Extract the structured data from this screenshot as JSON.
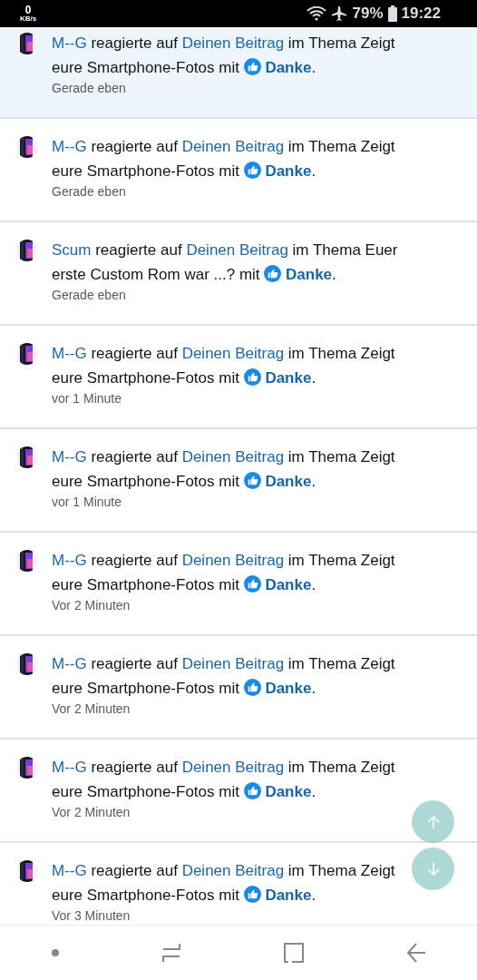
{
  "status_bar": {
    "speed_value": "0",
    "speed_unit": "KB/s",
    "battery": "79%",
    "time": "19:22"
  },
  "notifications": [
    {
      "user": "M--G",
      "verb": "reagierte auf",
      "post": "Deinen Beitrag",
      "middle": "im Thema Zeigt eure Smartphone-Fotos mit",
      "reaction": "Danke",
      "end": ".",
      "time": "Gerade eben",
      "unread": true
    },
    {
      "user": "M--G",
      "verb": "reagierte auf",
      "post": "Deinen Beitrag",
      "middle": "im Thema Zeigt eure Smartphone-Fotos mit",
      "reaction": "Danke",
      "end": ".",
      "time": "Gerade eben",
      "unread": false
    },
    {
      "user": "Scum",
      "verb": "reagierte auf",
      "post": "Deinen Beitrag",
      "middle": "im Thema Euer erste Custom Rom war ...? mit",
      "reaction": "Danke",
      "end": ".",
      "time": "Gerade eben",
      "unread": false
    },
    {
      "user": "M--G",
      "verb": "reagierte auf",
      "post": "Deinen Beitrag",
      "middle": "im Thema Zeigt eure Smartphone-Fotos mit",
      "reaction": "Danke",
      "end": ".",
      "time": "vor 1 Minute",
      "unread": false
    },
    {
      "user": "M--G",
      "verb": "reagierte auf",
      "post": "Deinen Beitrag",
      "middle": "im Thema Zeigt eure Smartphone-Fotos mit",
      "reaction": "Danke",
      "end": ".",
      "time": "vor 1 Minute",
      "unread": false
    },
    {
      "user": "M--G",
      "verb": "reagierte auf",
      "post": "Deinen Beitrag",
      "middle": "im Thema Zeigt eure Smartphone-Fotos mit",
      "reaction": "Danke",
      "end": ".",
      "time": "Vor 2 Minuten",
      "unread": false
    },
    {
      "user": "M--G",
      "verb": "reagierte auf",
      "post": "Deinen Beitrag",
      "middle": "im Thema Zeigt eure Smartphone-Fotos mit",
      "reaction": "Danke",
      "end": ".",
      "time": "Vor 2 Minuten",
      "unread": false
    },
    {
      "user": "M--G",
      "verb": "reagierte auf",
      "post": "Deinen Beitrag",
      "middle": "im Thema Zeigt eure Smartphone-Fotos mit",
      "reaction": "Danke",
      "end": ".",
      "time": "Vor 2 Minuten",
      "unread": false
    },
    {
      "user": "M--G",
      "verb": "reagierte auf",
      "post": "Deinen Beitrag",
      "middle": "im Thema Zeigt eure Smartphone-Fotos mit",
      "reaction": "Danke",
      "end": ".",
      "time": "Vor 3 Minuten",
      "unread": false
    }
  ]
}
